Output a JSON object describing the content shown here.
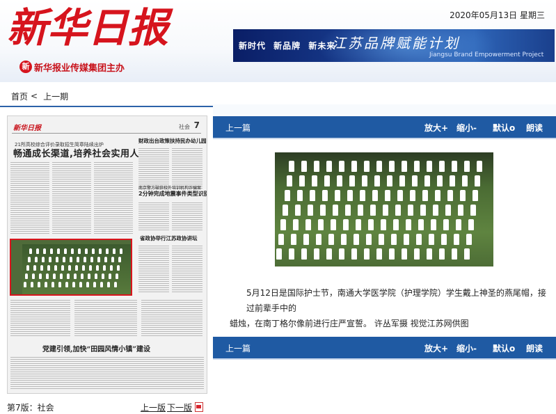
{
  "header": {
    "logo_title": "新华日报",
    "logo_sub_mark": "新",
    "logo_sub": "新华报业传媒集团主办",
    "date": "2020年05月13日",
    "weekday": "星期三",
    "banner": {
      "slogan": "新时代  新品牌  新未来",
      "title": "江苏品牌赋能计划",
      "subtitle_en": "Jiangsu Brand Empowerment Project"
    }
  },
  "nav": {
    "home": "首页",
    "separator": "<",
    "prev_issue": "上一期"
  },
  "paper": {
    "logo": "新华日报",
    "section": "社会",
    "page_no": "7",
    "sub_headline": "21所高校综合评价录取招生简章陆续出炉",
    "main_headline": "畅通成长渠道,培养社会实用人才",
    "right_headline_1": "财政出台政策扶持民办幼儿园",
    "right_small_1": "南京警方破获校外培训机构诈骗案",
    "right_headline_2": "2分钟完成地震事件类型识别",
    "right_headline_3": "省政协举行江苏政协讲坛",
    "bottom_headline": "党建引领,加快“田园风情小镇”建设"
  },
  "edition": {
    "label": "第7版：社会",
    "prev_page": "上一版",
    "next_page": "下一版",
    "pdf_icon": "pdf-icon"
  },
  "article": {
    "prev_article": "上一篇",
    "controls": {
      "zoom_in": "放大+",
      "zoom_out": "缩小-",
      "default": "默认o",
      "read_aloud": "朗读"
    },
    "photo_alt": "nurses-ceremony-photo",
    "caption_line1": "5月12日是国际护士节，南通大学医学院（护理学院）学生戴上神圣的燕尾帽，接过前辈手中的",
    "caption_line2": "蜡烛，在南丁格尔像前进行庄严宣誓。 许丛军摄 视觉江苏网供图"
  },
  "colors": {
    "brand_red": "#d6141d",
    "toolbar_blue": "#1f5aa3",
    "nav_line": "#2c62a8"
  }
}
